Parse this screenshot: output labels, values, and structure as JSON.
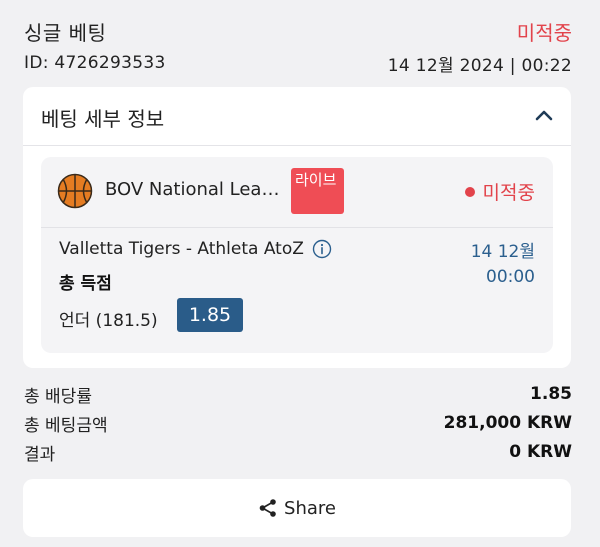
{
  "header": {
    "title": "싱글 베팅",
    "status": "미적중",
    "bet_id": "ID: 4726293533",
    "datetime": "14 12월 2024 | 00:22"
  },
  "details": {
    "title": "베팅 세부 정보",
    "toggle_icon": "chevron-up-icon"
  },
  "bet": {
    "sport_icon": "basketball-icon",
    "league": "BOV National Lea…",
    "live_badge": "라이브",
    "status": "미적중",
    "match": "Valletta Tigers - Athleta AtoZ",
    "match_info_icon": "info-icon",
    "date": "14 12월",
    "time": "00:00",
    "market": "총 득점",
    "selection": "언더 (181.5)",
    "odds": "1.85"
  },
  "summary": {
    "total_odds_label": "총 배당률",
    "total_odds_value": "1.85",
    "total_stake_label": "총 베팅금액",
    "total_stake_value": "281,000 KRW",
    "result_label": "결과",
    "result_value": "0 KRW"
  },
  "share": {
    "label": "Share",
    "icon": "share-icon"
  },
  "colors": {
    "background": "#f1f1f3",
    "status_red": "#e2434b",
    "live_badge": "#ef4d55",
    "odds_blue": "#2a5c89",
    "date_blue": "#2b5f8e",
    "basketball_orange": "#e57c22"
  }
}
